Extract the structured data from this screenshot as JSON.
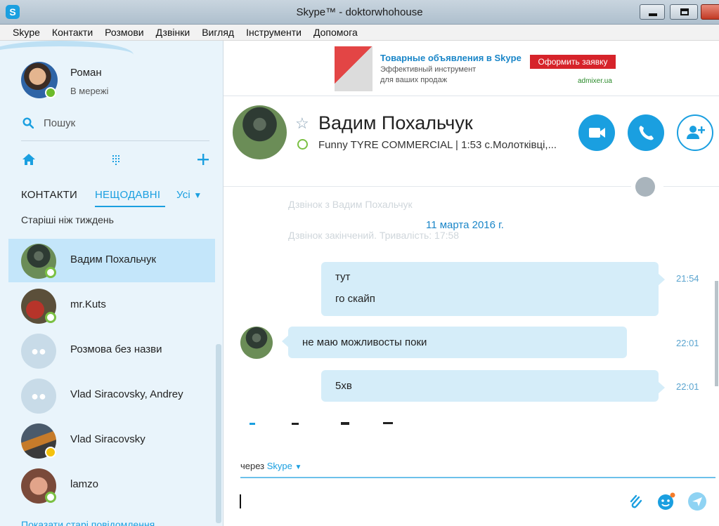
{
  "window": {
    "title": "Skype™ - doktorwhohouse",
    "app_icon": "S"
  },
  "menu": [
    "Skype",
    "Контакти",
    "Розмови",
    "Дзвінки",
    "Вигляд",
    "Інструменти",
    "Допомога"
  ],
  "profile": {
    "name": "Роман",
    "status": "В мережі"
  },
  "search": {
    "label": "Пошук"
  },
  "tabs": {
    "contacts": "КОНТАКТИ",
    "recent": "НЕЩОДАВНІ",
    "all": "Усі"
  },
  "older_label": "Старіші ніж тиждень",
  "contacts": [
    {
      "name": "Вадим Похальчук",
      "presence": "offline",
      "selected": true
    },
    {
      "name": "mr.Kuts",
      "presence": "offline"
    },
    {
      "name": "Розмова без назви",
      "presence": "group"
    },
    {
      "name": "Vlad Siracovsky, Andrey",
      "presence": "group"
    },
    {
      "name": "Vlad Siracovsky",
      "presence": "away"
    },
    {
      "name": "lamzo",
      "presence": "offline"
    }
  ],
  "older_link": "Показати старі повідомлення",
  "ad": {
    "title": "Товарные объявления в Skype",
    "line1": "Эффективный инструмент",
    "line2": "для ваших продаж",
    "button": "Оформить заявку",
    "domain": "admixer.ua"
  },
  "chat": {
    "name": "Вадим Похальчук",
    "mood": "Funny TYRE COMMERCIAL  |  1:53 с.Молотківці,...",
    "faded_line1": "Дзвінок з Вадим Похальчук",
    "faded_line2": "Дзвінок закінчений. Тривалість: 17:58",
    "date": "11 марта 2016 г.",
    "messages": [
      {
        "lines": [
          "тут",
          "го скайп"
        ],
        "time": "21:54",
        "direction": "out"
      },
      {
        "lines": [
          "не маю можливосты поки"
        ],
        "time": "22:01",
        "direction": "in"
      },
      {
        "lines": [
          "5хв"
        ],
        "time": "22:01",
        "direction": "out"
      }
    ]
  },
  "compose": {
    "via_prefix": "через",
    "via_service": "Skype",
    "placeholder": ""
  },
  "colors": {
    "accent": "#1a9fe0",
    "bubble": "#d5edf9",
    "sidebar": "#e9f4fb",
    "selected": "#c4e6fa"
  }
}
